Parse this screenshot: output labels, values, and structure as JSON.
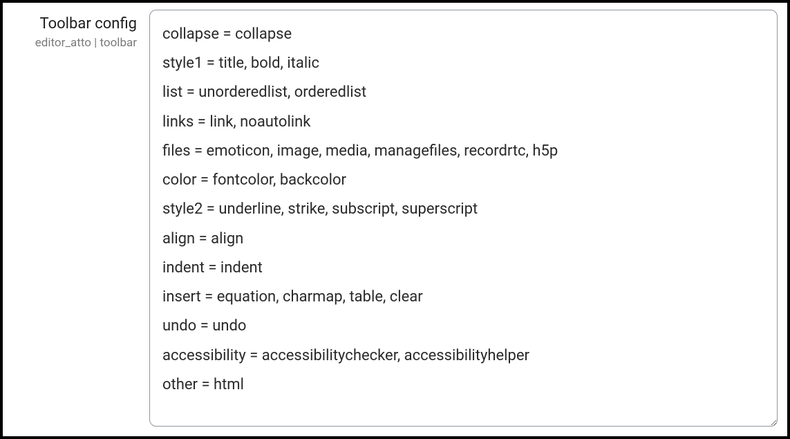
{
  "setting": {
    "label": "Toolbar config",
    "identifier": "editor_atto | toolbar",
    "value": "collapse = collapse\nstyle1 = title, bold, italic\nlist = unorderedlist, orderedlist\nlinks = link, noautolink\nfiles = emoticon, image, media, managefiles, recordrtc, h5p\ncolor = fontcolor, backcolor\nstyle2 = underline, strike, subscript, superscript\nalign = align\nindent = indent\ninsert = equation, charmap, table, clear\nundo = undo\naccessibility = accessibilitychecker, accessibilityhelper\nother = html"
  }
}
